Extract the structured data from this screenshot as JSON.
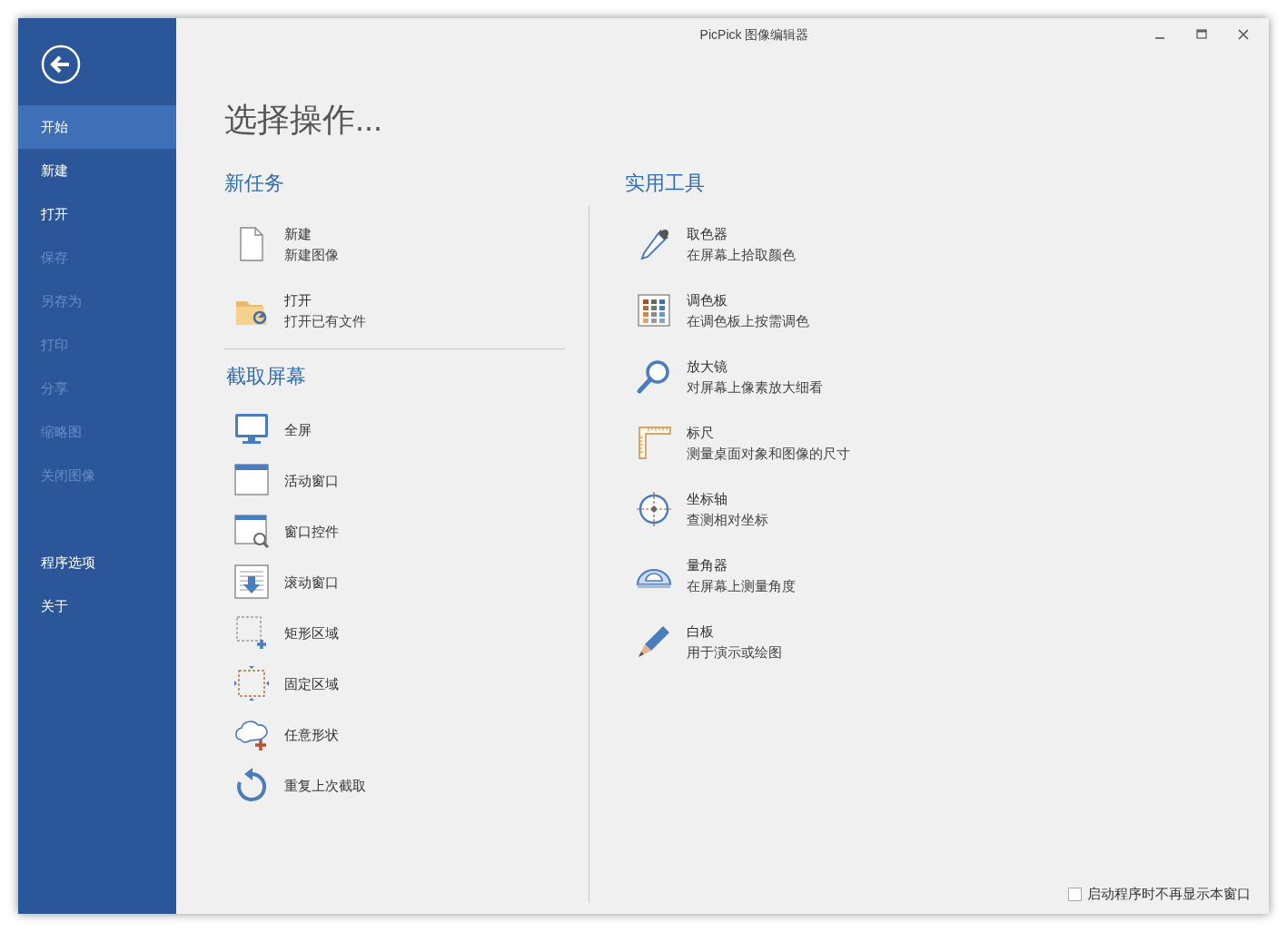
{
  "window": {
    "title": "PicPick 图像编辑器"
  },
  "sidebar": {
    "items": [
      {
        "label": "开始",
        "selected": true,
        "disabled": false
      },
      {
        "label": "新建",
        "selected": false,
        "disabled": false
      },
      {
        "label": "打开",
        "selected": false,
        "disabled": false
      },
      {
        "label": "保存",
        "selected": false,
        "disabled": true
      },
      {
        "label": "另存为",
        "selected": false,
        "disabled": true
      },
      {
        "label": "打印",
        "selected": false,
        "disabled": true
      },
      {
        "label": "分享",
        "selected": false,
        "disabled": true
      },
      {
        "label": "缩略图",
        "selected": false,
        "disabled": true
      },
      {
        "label": "关闭图像",
        "selected": false,
        "disabled": true
      }
    ],
    "bottom_items": [
      {
        "label": "程序选项",
        "selected": false,
        "disabled": false
      },
      {
        "label": "关于",
        "selected": false,
        "disabled": false
      }
    ]
  },
  "heading": "选择操作...",
  "new_task": {
    "title": "新任务",
    "items": [
      {
        "kind": "document",
        "title": "新建",
        "description": "新建图像"
      },
      {
        "kind": "folder",
        "title": "打开",
        "description": "打开已有文件"
      }
    ]
  },
  "capture": {
    "title": "截取屏幕",
    "items": [
      {
        "kind": "monitor",
        "title": "全屏"
      },
      {
        "kind": "window",
        "title": "活动窗口"
      },
      {
        "kind": "control",
        "title": "窗口控件"
      },
      {
        "kind": "scroll",
        "title": "滚动窗口"
      },
      {
        "kind": "region",
        "title": "矩形区域"
      },
      {
        "kind": "fixed",
        "title": "固定区域"
      },
      {
        "kind": "freehand",
        "title": "任意形状"
      },
      {
        "kind": "repeat",
        "title": "重复上次截取"
      }
    ]
  },
  "tools": {
    "title": "实用工具",
    "items": [
      {
        "kind": "picker",
        "title": "取色器",
        "description": "在屏幕上拾取颜色"
      },
      {
        "kind": "palette",
        "title": "调色板",
        "description": "在调色板上按需调色"
      },
      {
        "kind": "magnifier",
        "title": "放大镜",
        "description": "对屏幕上像素放大细看"
      },
      {
        "kind": "ruler",
        "title": "标尺",
        "description": "测量桌面对象和图像的尺寸"
      },
      {
        "kind": "crosshair",
        "title": "坐标轴",
        "description": "查测相对坐标"
      },
      {
        "kind": "protractor",
        "title": "量角器",
        "description": "在屏幕上测量角度"
      },
      {
        "kind": "pen",
        "title": "白板",
        "description": "用于演示或绘图"
      }
    ]
  },
  "footer": {
    "checkbox": {
      "label": "启动程序时不再显示本窗口",
      "checked": false
    }
  }
}
